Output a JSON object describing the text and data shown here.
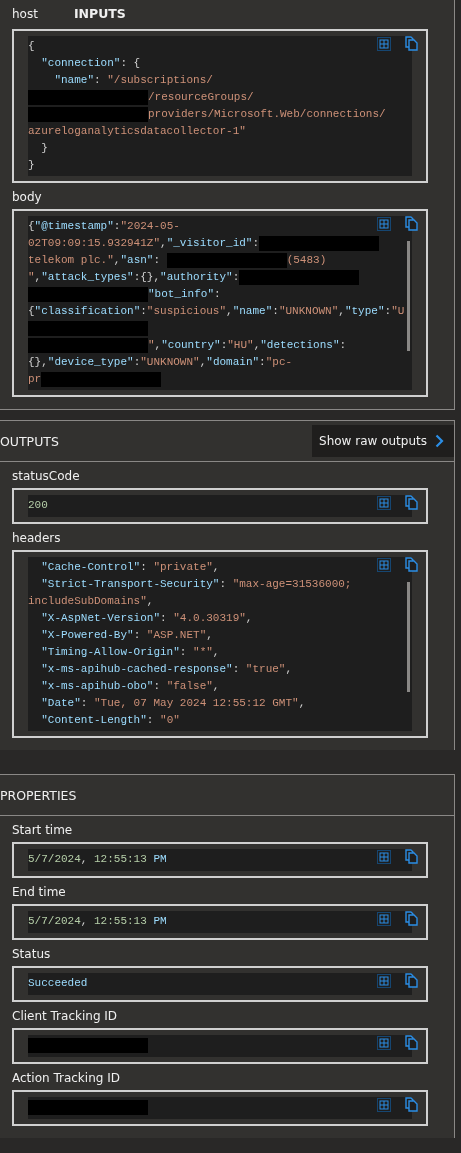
{
  "inputs": {
    "title": "INPUTS",
    "fields": [
      {
        "label": "host",
        "scrollable": false,
        "lines": [
          [
            {
              "kind": "punct",
              "text": "{"
            }
          ],
          [
            {
              "kind": "key",
              "text": "  \"connection\""
            },
            {
              "kind": "punct",
              "text": ": {"
            }
          ],
          [
            {
              "kind": "key",
              "text": "    \"name\""
            },
            {
              "kind": "punct",
              "text": ": "
            },
            {
              "kind": "string",
              "text": "\"/subscriptions/"
            }
          ],
          [
            {
              "kind": "redacted"
            },
            {
              "kind": "string",
              "text": "/resourceGroups/"
            }
          ],
          [
            {
              "kind": "redacted"
            },
            {
              "kind": "string",
              "text": "providers/Microsoft.Web/connections/"
            }
          ],
          [
            {
              "kind": "string",
              "text": "azureloganalyticsdatacollector-1\""
            }
          ],
          [
            {
              "kind": "punct",
              "text": "  }"
            }
          ],
          [
            {
              "kind": "punct",
              "text": "}"
            }
          ]
        ]
      },
      {
        "label": "body",
        "scrollable": true,
        "lines": [
          [
            {
              "kind": "punct",
              "text": "{"
            },
            {
              "kind": "key",
              "text": "\"@timestamp\""
            },
            {
              "kind": "punct",
              "text": ":"
            },
            {
              "kind": "string",
              "text": "\"2024-05-"
            }
          ],
          [
            {
              "kind": "string",
              "text": "02T09:09:15.932941Z\""
            },
            {
              "kind": "punct",
              "text": ","
            },
            {
              "kind": "key",
              "text": "\"_visitor_id\""
            },
            {
              "kind": "punct",
              "text": ":"
            },
            {
              "kind": "redacted"
            }
          ],
          [
            {
              "kind": "string",
              "text": "telekom plc.\""
            },
            {
              "kind": "punct",
              "text": ","
            },
            {
              "kind": "key",
              "text": "\"asn\""
            },
            {
              "kind": "punct",
              "text": ": "
            },
            {
              "kind": "redacted"
            },
            {
              "kind": "string",
              "text": "(5483)"
            }
          ],
          [
            {
              "kind": "string",
              "text": "\""
            },
            {
              "kind": "punct",
              "text": ","
            },
            {
              "kind": "key",
              "text": "\"attack_types\""
            },
            {
              "kind": "punct",
              "text": ":{},"
            },
            {
              "kind": "key",
              "text": "\"authority\""
            },
            {
              "kind": "punct",
              "text": ":"
            },
            {
              "kind": "redacted"
            }
          ],
          [
            {
              "kind": "redacted"
            },
            {
              "kind": "key",
              "text": "\"bot_info\""
            },
            {
              "kind": "punct",
              "text": ":"
            }
          ],
          [
            {
              "kind": "punct",
              "text": "{"
            },
            {
              "kind": "key",
              "text": "\"classification\""
            },
            {
              "kind": "punct",
              "text": ":"
            },
            {
              "kind": "string",
              "text": "\"suspicious\""
            },
            {
              "kind": "punct",
              "text": ","
            },
            {
              "kind": "key",
              "text": "\"name\""
            },
            {
              "kind": "punct",
              "text": ":"
            },
            {
              "kind": "string",
              "text": "\"UNKNOWN\""
            },
            {
              "kind": "punct",
              "text": ","
            },
            {
              "kind": "key",
              "text": "\"type\""
            },
            {
              "kind": "punct",
              "text": ":"
            },
            {
              "kind": "string",
              "text": "\"U"
            }
          ],
          [
            {
              "kind": "redacted"
            }
          ],
          [
            {
              "kind": "redacted"
            },
            {
              "kind": "string",
              "text": "\""
            },
            {
              "kind": "punct",
              "text": ","
            },
            {
              "kind": "key",
              "text": "\"country\""
            },
            {
              "kind": "punct",
              "text": ":"
            },
            {
              "kind": "string",
              "text": "\"HU\""
            },
            {
              "kind": "punct",
              "text": ","
            },
            {
              "kind": "key",
              "text": "\"detections\""
            },
            {
              "kind": "punct",
              "text": ":"
            }
          ],
          [
            {
              "kind": "punct",
              "text": "{},"
            },
            {
              "kind": "key",
              "text": "\"device_type\""
            },
            {
              "kind": "punct",
              "text": ":"
            },
            {
              "kind": "string",
              "text": "\"UNKNOWN\""
            },
            {
              "kind": "punct",
              "text": ","
            },
            {
              "kind": "key",
              "text": "\"domain\""
            },
            {
              "kind": "punct",
              "text": ":"
            },
            {
              "kind": "string",
              "text": "\"pc-"
            }
          ],
          [
            {
              "kind": "string",
              "text": "pr"
            },
            {
              "kind": "redacted"
            }
          ]
        ]
      }
    ]
  },
  "outputs": {
    "title": "OUTPUTS",
    "raw_button": "Show raw outputs",
    "fields": [
      {
        "label": "statusCode",
        "scrollable": false,
        "lines": [
          [
            {
              "kind": "number",
              "text": "200"
            }
          ]
        ]
      },
      {
        "label": "headers",
        "scrollable": true,
        "lines": [
          [
            {
              "kind": "key",
              "text": "  \"Cache-Control\""
            },
            {
              "kind": "punct",
              "text": ": "
            },
            {
              "kind": "string",
              "text": "\"private\""
            },
            {
              "kind": "punct",
              "text": ","
            }
          ],
          [
            {
              "kind": "key",
              "text": "  \"Strict-Transport-Security\""
            },
            {
              "kind": "punct",
              "text": ": "
            },
            {
              "kind": "string",
              "text": "\"max-age=31536000;"
            }
          ],
          [
            {
              "kind": "string",
              "text": "includeSubDomains\""
            },
            {
              "kind": "punct",
              "text": ","
            }
          ],
          [
            {
              "kind": "key",
              "text": "  \"X-AspNet-Version\""
            },
            {
              "kind": "punct",
              "text": ": "
            },
            {
              "kind": "string",
              "text": "\"4.0.30319\""
            },
            {
              "kind": "punct",
              "text": ","
            }
          ],
          [
            {
              "kind": "key",
              "text": "  \"X-Powered-By\""
            },
            {
              "kind": "punct",
              "text": ": "
            },
            {
              "kind": "string",
              "text": "\"ASP.NET\""
            },
            {
              "kind": "punct",
              "text": ","
            }
          ],
          [
            {
              "kind": "key",
              "text": "  \"Timing-Allow-Origin\""
            },
            {
              "kind": "punct",
              "text": ": "
            },
            {
              "kind": "string",
              "text": "\"*\""
            },
            {
              "kind": "punct",
              "text": ","
            }
          ],
          [
            {
              "kind": "key",
              "text": "  \"x-ms-apihub-cached-response\""
            },
            {
              "kind": "punct",
              "text": ": "
            },
            {
              "kind": "string",
              "text": "\"true\""
            },
            {
              "kind": "punct",
              "text": ","
            }
          ],
          [
            {
              "kind": "key",
              "text": "  \"x-ms-apihub-obo\""
            },
            {
              "kind": "punct",
              "text": ": "
            },
            {
              "kind": "string",
              "text": "\"false\""
            },
            {
              "kind": "punct",
              "text": ","
            }
          ],
          [
            {
              "kind": "key",
              "text": "  \"Date\""
            },
            {
              "kind": "punct",
              "text": ": "
            },
            {
              "kind": "string",
              "text": "\"Tue, 07 May 2024 12:55:12 GMT\""
            },
            {
              "kind": "punct",
              "text": ","
            }
          ],
          [
            {
              "kind": "key",
              "text": "  \"Content-Length\""
            },
            {
              "kind": "punct",
              "text": ": "
            },
            {
              "kind": "string",
              "text": "\"0\""
            }
          ]
        ]
      }
    ]
  },
  "properties": {
    "title": "PROPERTIES",
    "fields": [
      {
        "label": "Start time",
        "scrollable": false,
        "lines": [
          [
            {
              "kind": "number",
              "text": "5/7/2024"
            },
            {
              "kind": "punct",
              "text": ", "
            },
            {
              "kind": "number",
              "text": "12:55:13"
            },
            {
              "kind": "keyword",
              "text": " PM"
            }
          ]
        ]
      },
      {
        "label": "End time",
        "scrollable": false,
        "lines": [
          [
            {
              "kind": "number",
              "text": "5/7/2024"
            },
            {
              "kind": "punct",
              "text": ", "
            },
            {
              "kind": "number",
              "text": "12:55:13"
            },
            {
              "kind": "keyword",
              "text": " PM"
            }
          ]
        ]
      },
      {
        "label": "Status",
        "scrollable": false,
        "lines": [
          [
            {
              "kind": "keyword",
              "text": "Succeeded"
            }
          ]
        ]
      },
      {
        "label": "Client Tracking ID",
        "scrollable": false,
        "lines": [
          [
            {
              "kind": "redacted"
            }
          ]
        ]
      },
      {
        "label": "Action Tracking ID",
        "scrollable": false,
        "lines": [
          [
            {
              "kind": "redacted"
            }
          ]
        ]
      }
    ]
  }
}
